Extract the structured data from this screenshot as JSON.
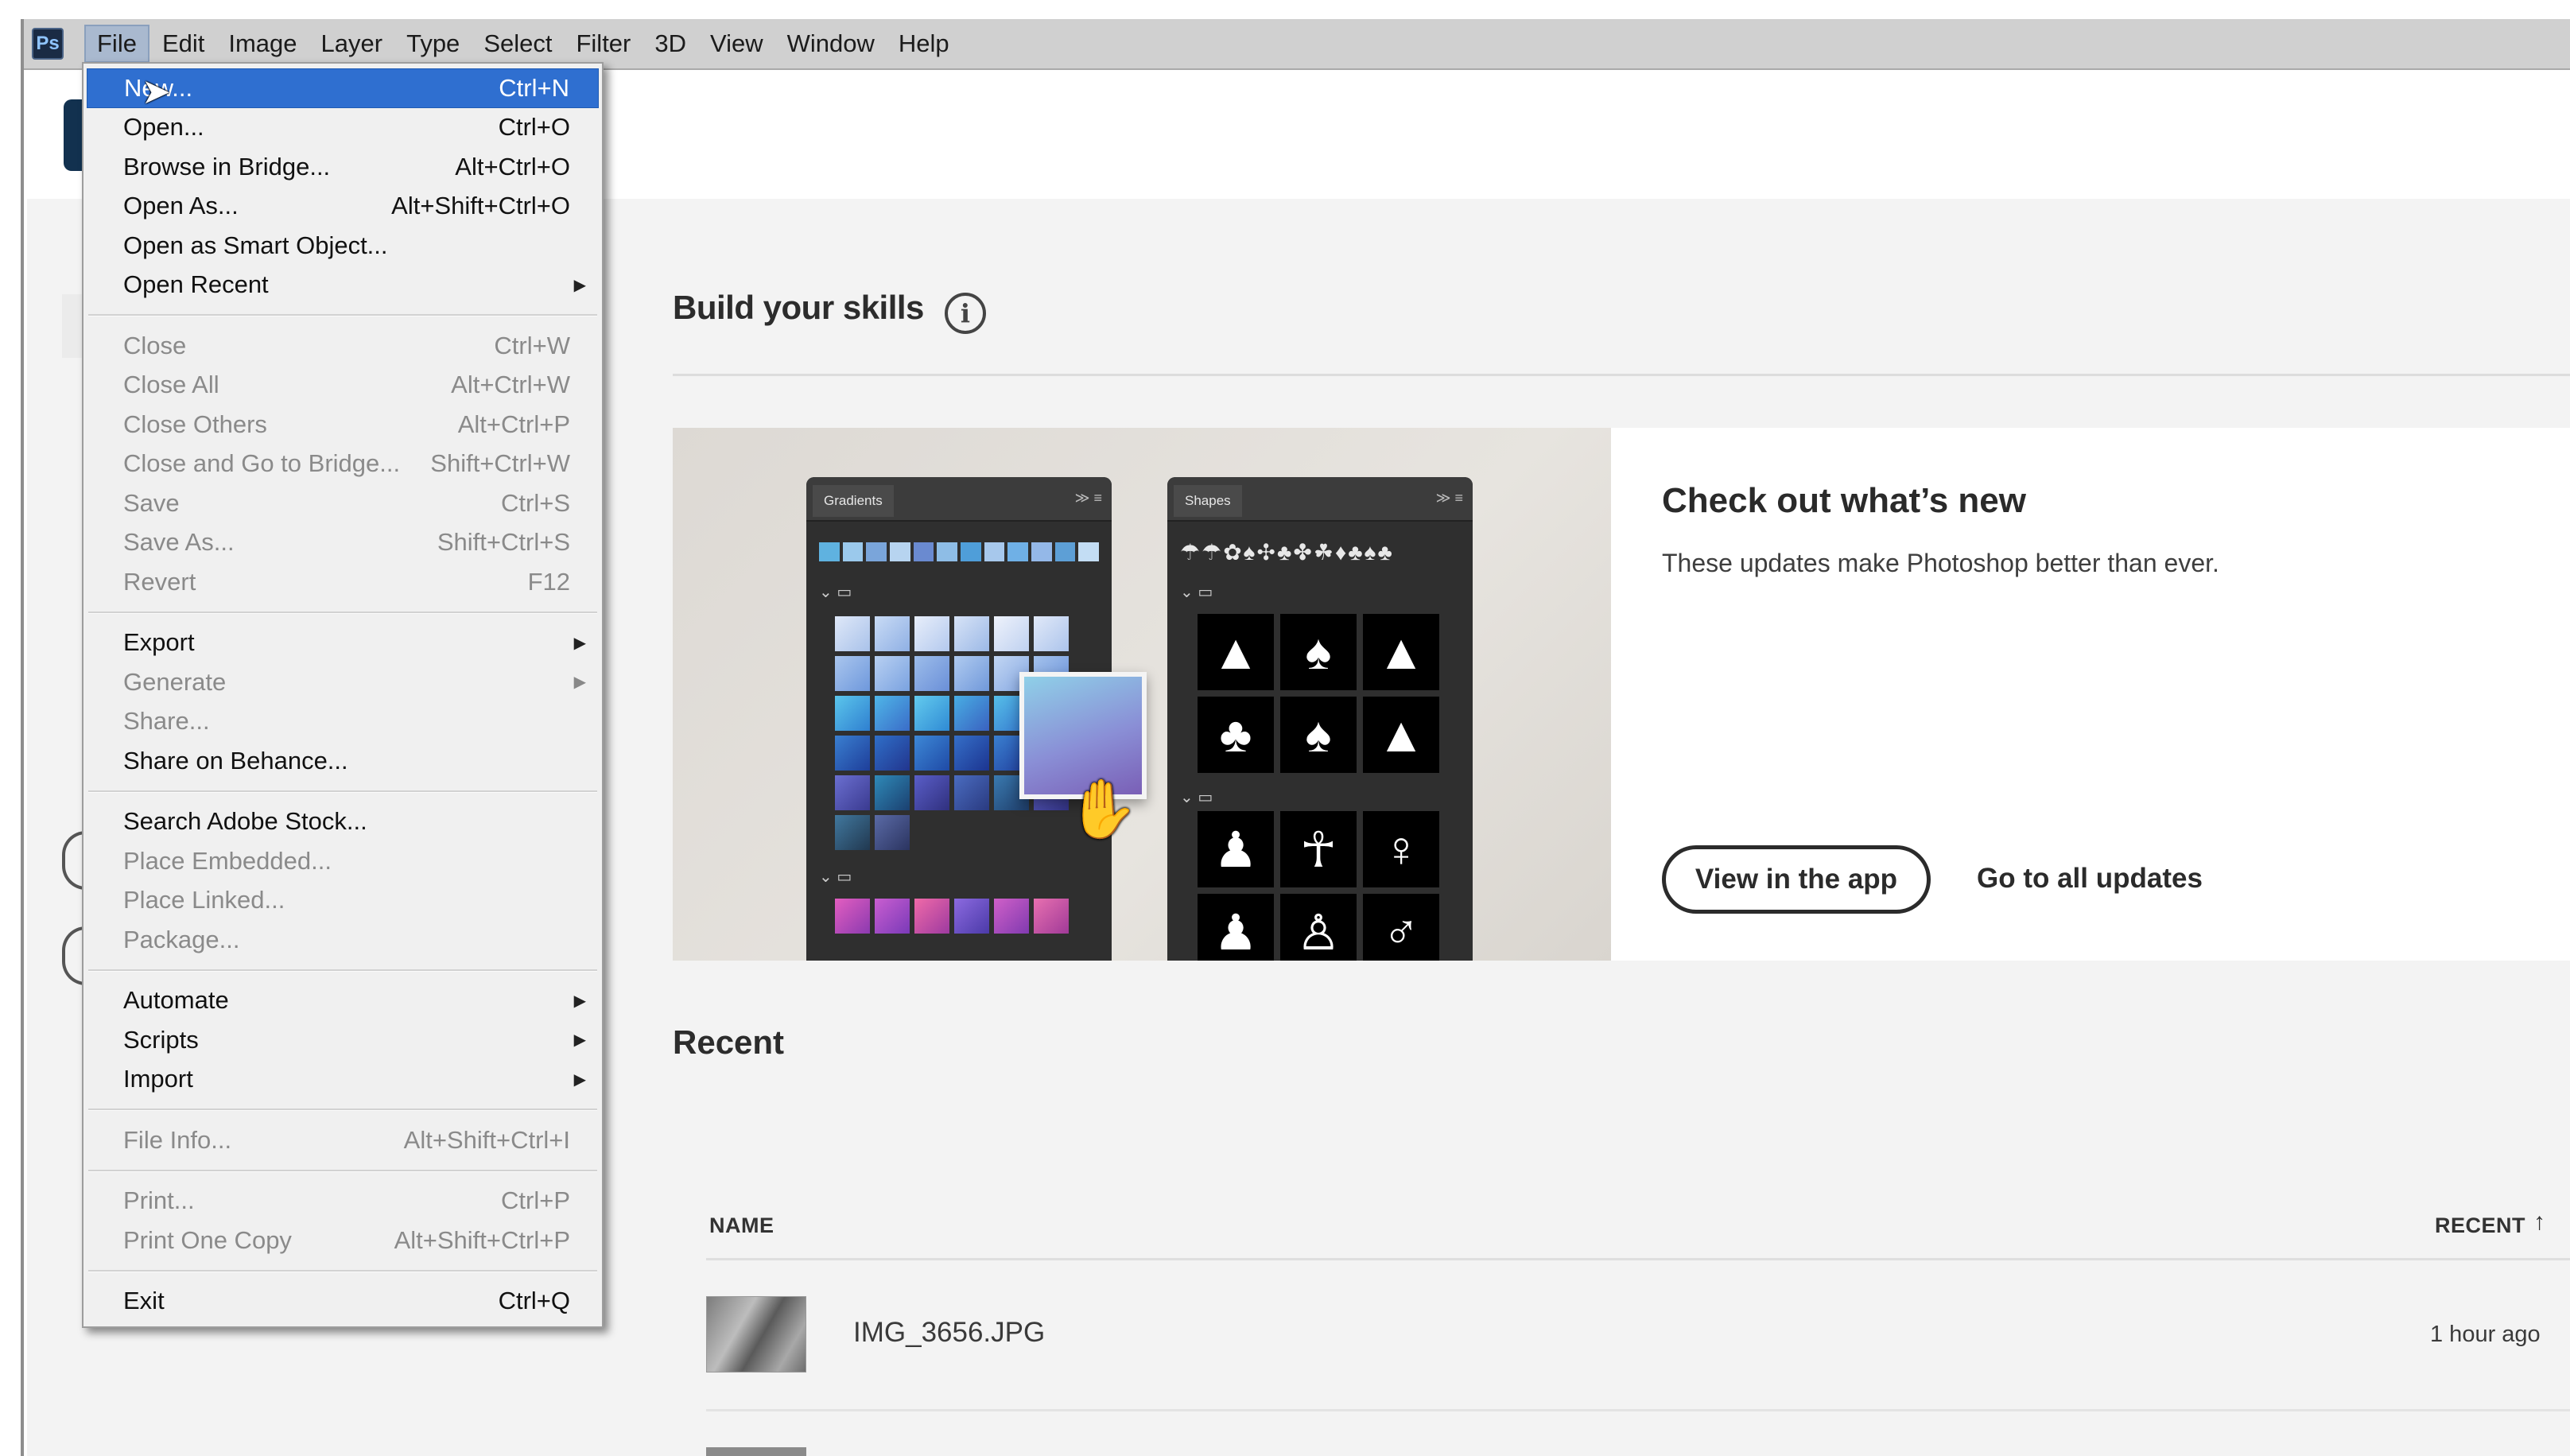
{
  "app": {
    "logo_text": "Ps"
  },
  "menubar": {
    "items": [
      "File",
      "Edit",
      "Image",
      "Layer",
      "Type",
      "Select",
      "Filter",
      "3D",
      "View",
      "Window",
      "Help"
    ],
    "active": "File"
  },
  "file_menu": {
    "groups": [
      [
        {
          "label": "New...",
          "shortcut": "Ctrl+N",
          "state": "highlight"
        },
        {
          "label": "Open...",
          "shortcut": "Ctrl+O",
          "state": "enabled"
        },
        {
          "label": "Browse in Bridge...",
          "shortcut": "Alt+Ctrl+O",
          "state": "enabled"
        },
        {
          "label": "Open As...",
          "shortcut": "Alt+Shift+Ctrl+O",
          "state": "enabled"
        },
        {
          "label": "Open as Smart Object...",
          "shortcut": "",
          "state": "enabled"
        },
        {
          "label": "Open Recent",
          "shortcut": "",
          "state": "enabled",
          "submenu": true
        }
      ],
      [
        {
          "label": "Close",
          "shortcut": "Ctrl+W",
          "state": "disabled"
        },
        {
          "label": "Close All",
          "shortcut": "Alt+Ctrl+W",
          "state": "disabled"
        },
        {
          "label": "Close Others",
          "shortcut": "Alt+Ctrl+P",
          "state": "disabled"
        },
        {
          "label": "Close and Go to Bridge...",
          "shortcut": "Shift+Ctrl+W",
          "state": "disabled"
        },
        {
          "label": "Save",
          "shortcut": "Ctrl+S",
          "state": "disabled"
        },
        {
          "label": "Save As...",
          "shortcut": "Shift+Ctrl+S",
          "state": "disabled"
        },
        {
          "label": "Revert",
          "shortcut": "F12",
          "state": "disabled"
        }
      ],
      [
        {
          "label": "Export",
          "shortcut": "",
          "state": "enabled",
          "submenu": true
        },
        {
          "label": "Generate",
          "shortcut": "",
          "state": "disabled",
          "submenu": true
        },
        {
          "label": "Share...",
          "shortcut": "",
          "state": "disabled"
        },
        {
          "label": "Share on Behance...",
          "shortcut": "",
          "state": "enabled"
        }
      ],
      [
        {
          "label": "Search Adobe Stock...",
          "shortcut": "",
          "state": "enabled"
        },
        {
          "label": "Place Embedded...",
          "shortcut": "",
          "state": "disabled"
        },
        {
          "label": "Place Linked...",
          "shortcut": "",
          "state": "disabled"
        },
        {
          "label": "Package...",
          "shortcut": "",
          "state": "disabled"
        }
      ],
      [
        {
          "label": "Automate",
          "shortcut": "",
          "state": "enabled",
          "submenu": true
        },
        {
          "label": "Scripts",
          "shortcut": "",
          "state": "enabled",
          "submenu": true
        },
        {
          "label": "Import",
          "shortcut": "",
          "state": "enabled",
          "submenu": true
        }
      ],
      [
        {
          "label": "File Info...",
          "shortcut": "Alt+Shift+Ctrl+I",
          "state": "disabled"
        }
      ],
      [
        {
          "label": "Print...",
          "shortcut": "Ctrl+P",
          "state": "disabled"
        },
        {
          "label": "Print One Copy",
          "shortcut": "Alt+Shift+Ctrl+P",
          "state": "disabled"
        }
      ],
      [
        {
          "label": "Exit",
          "shortcut": "Ctrl+Q",
          "state": "enabled"
        }
      ]
    ]
  },
  "home": {
    "build_title": "Build your skills",
    "info_icon": "i",
    "feature": {
      "title": "Check out what’s new",
      "subtitle": "These updates make Photoshop better than ever.",
      "primary_button": "View in the app",
      "secondary_link": "Go to all updates",
      "panel_gradients_tab": "Gradients",
      "panel_shapes_tab": "Shapes"
    },
    "recent": {
      "title": "Recent",
      "columns": {
        "name": "NAME",
        "recent": "RECENT"
      },
      "rows": [
        {
          "name": "IMG_3656.JPG",
          "time": "1 hour ago"
        }
      ]
    }
  },
  "colors": {
    "menubar_bg": "#d0d0d0",
    "menu_highlight": "#2f6fd0",
    "home_bg": "#f3f3f3",
    "ps_logo_bg": "#1a2b44"
  }
}
